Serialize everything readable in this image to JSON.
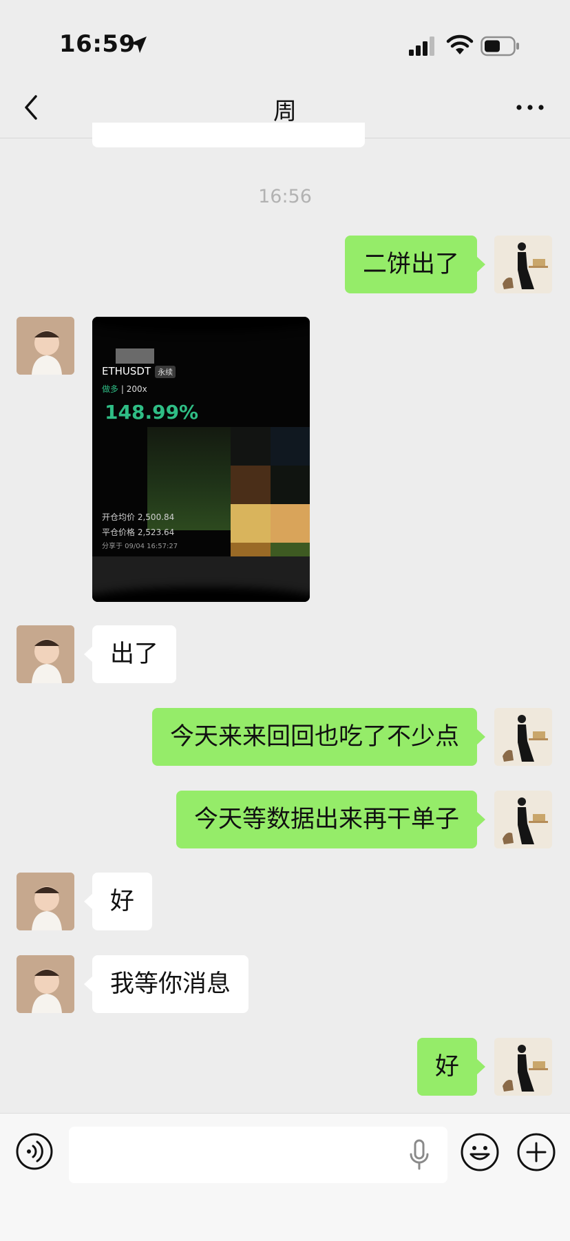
{
  "status_bar": {
    "time": "16:59"
  },
  "nav": {
    "title": "周",
    "back_icon": "chevron-left-icon",
    "more_icon": "ellipsis-icon"
  },
  "chat": {
    "timestamp": "16:56",
    "messages": [
      {
        "side": "right",
        "type": "text",
        "text": "二饼出了"
      },
      {
        "side": "left",
        "type": "image",
        "image": {
          "symbol": "ETHUSDT",
          "tag": "永续",
          "direction": "做多",
          "leverage": "200x",
          "pnl_percent": "148.99%",
          "open_label": "开仓均价",
          "open_price": "2,500.84",
          "close_label": "平仓价格",
          "close_price": "2,523.64",
          "shared_at": "分享于 09/04 16:57:27"
        }
      },
      {
        "side": "left",
        "type": "text",
        "text": "出了"
      },
      {
        "side": "right",
        "type": "text",
        "text": "今天来来回回也吃了不少点"
      },
      {
        "side": "right",
        "type": "text",
        "text": "今天等数据出来再干单子"
      },
      {
        "side": "left",
        "type": "text",
        "text": "好"
      },
      {
        "side": "left",
        "type": "text",
        "text": "我等你消息"
      },
      {
        "side": "right",
        "type": "text",
        "text": "好"
      }
    ]
  },
  "input_bar": {
    "voice_icon": "voice-icon",
    "mic_icon": "microphone-icon",
    "emoji_icon": "emoji-icon",
    "plus_icon": "plus-icon"
  },
  "colors": {
    "sent_bubble": "#95ec69",
    "received_bubble": "#ffffff",
    "background": "#ededed",
    "profit_green": "#2fbd85"
  }
}
